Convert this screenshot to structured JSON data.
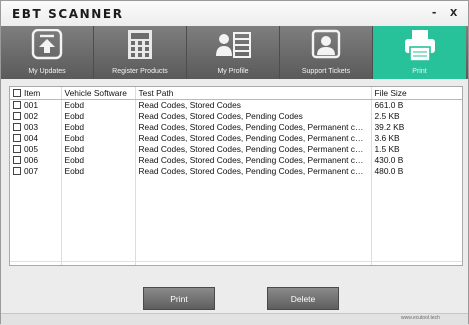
{
  "window": {
    "title": "EBT SCANNER",
    "minimize": "-",
    "close": "x"
  },
  "nav": {
    "items": [
      {
        "label": "My Updates",
        "icon": "upload-icon"
      },
      {
        "label": "Register Products",
        "icon": "calculator-icon"
      },
      {
        "label": "My Profile",
        "icon": "profile-icon"
      },
      {
        "label": "Support Tickets",
        "icon": "support-icon"
      },
      {
        "label": "Print",
        "icon": "printer-icon",
        "active": true
      }
    ],
    "active_color": "#27c29a"
  },
  "table": {
    "columns": [
      "Item",
      "Vehicle Software",
      "Test Path",
      "File Size"
    ],
    "rows": [
      {
        "item": "001",
        "software": "Eobd",
        "path": "Read Codes, Stored Codes",
        "size": "661.0 B"
      },
      {
        "item": "002",
        "software": "Eobd",
        "path": "Read Codes, Stored Codes, Pending Codes",
        "size": "2.5 KB"
      },
      {
        "item": "003",
        "software": "Eobd",
        "path": "Read Codes, Stored Codes, Pending Codes, Permanent code...",
        "size": "39.2 KB"
      },
      {
        "item": "004",
        "software": "Eobd",
        "path": "Read Codes, Stored Codes, Pending Codes, Permanent code...",
        "size": "3.6 KB"
      },
      {
        "item": "005",
        "software": "Eobd",
        "path": "Read Codes, Stored Codes, Pending Codes, Permanent code...",
        "size": "1.5 KB"
      },
      {
        "item": "006",
        "software": "Eobd",
        "path": "Read Codes, Stored Codes, Pending Codes, Permanent code...",
        "size": "430.0 B"
      },
      {
        "item": "007",
        "software": "Eobd",
        "path": "Read Codes, Stored Codes, Pending Codes, Permanent code...",
        "size": "480.0 B"
      }
    ]
  },
  "actions": {
    "print": "Print",
    "delete": "Delete"
  },
  "status": {
    "text": "www.ecutool.tech"
  }
}
